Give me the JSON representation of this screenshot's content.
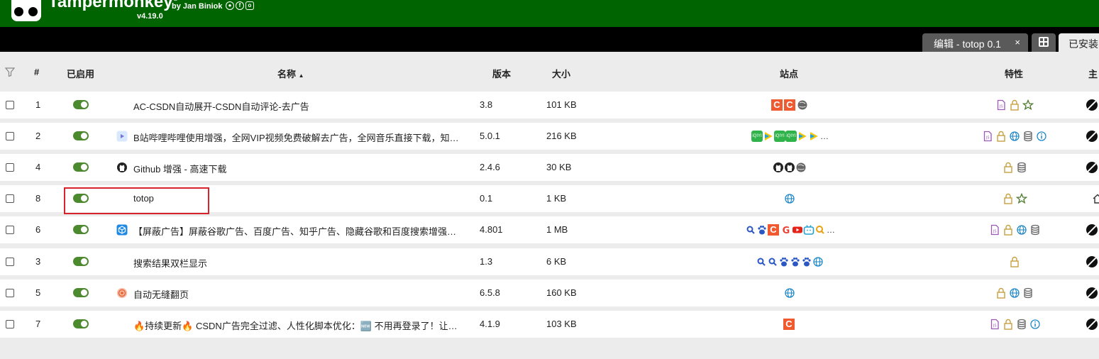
{
  "header": {
    "brand": "Tampermonkey",
    "reg_mark": "®",
    "byline": "by Jan Biniok",
    "version": "v4.19.0",
    "social_icons": [
      "github-icon",
      "facebook-icon",
      "instagram-icon"
    ],
    "bg_color": "#006400"
  },
  "tabs": {
    "edit_label": "编辑 - totop 0.1",
    "edit_close": "×",
    "installed_label": "已安装"
  },
  "table": {
    "headers": {
      "index": "#",
      "enabled": "已启用",
      "name": "名称",
      "sort_indicator": "▲",
      "version": "版本",
      "size": "大小",
      "sites": "站点",
      "features": "特性",
      "homepage": "主"
    },
    "rows": [
      {
        "index": "1",
        "enabled": true,
        "icon": "none",
        "name": "AC-CSDN自动展开-CSDN自动评论-去广告",
        "version": "3.8",
        "size": "101 KB",
        "sites": [
          "csdn-icon",
          "csdn-icon",
          "globe-gray-icon"
        ],
        "features": [
          "userscript-icon",
          "lock-icon",
          "star-icon"
        ],
        "home_icon": "homepage-icon"
      },
      {
        "index": "2",
        "enabled": true,
        "icon": "bilibili-icon",
        "name": "B站哔哩哔哩使用增强，全网VIP视频免费破解去广告，全网音乐直接下载，知…",
        "version": "5.0.1",
        "size": "216 KB",
        "sites": [
          "iqiyi-icon",
          "play-icon",
          "iqiyi-icon",
          "iqiyi-icon",
          "play-icon",
          "play-icon"
        ],
        "sites_more": "…",
        "features": [
          "userscript-icon",
          "lock-icon",
          "globe-icon",
          "database-icon",
          "info-icon"
        ],
        "home_icon": "homepage-icon"
      },
      {
        "index": "4",
        "enabled": true,
        "icon": "github-icon",
        "name": "Github 增强 - 高速下载",
        "version": "2.4.6",
        "size": "30 KB",
        "sites": [
          "github-icon",
          "github-icon",
          "globe-gray-icon"
        ],
        "features": [
          "lock-icon",
          "database-icon"
        ],
        "home_icon": "homepage-icon"
      },
      {
        "index": "8",
        "enabled": true,
        "icon": "none",
        "name": "totop",
        "version": "0.1",
        "size": "1 KB",
        "sites": [
          "globe-icon"
        ],
        "features": [
          "lock-icon",
          "star-icon"
        ],
        "home_icon": "house-icon"
      },
      {
        "index": "6",
        "enabled": true,
        "icon": "cube-icon",
        "name": "【屏蔽广告】屏蔽谷歌广告、百度广告、知乎广告、隐藏谷歌和百度搜索增强…",
        "version": "4.801",
        "size": "1 MB",
        "sites": [
          "search-icon",
          "baidu-icon",
          "csdn-icon",
          "google-icon",
          "youtube-icon",
          "bilibili-icon",
          "search-yellow-icon"
        ],
        "sites_more": "…",
        "features": [
          "userscript-icon",
          "lock-icon",
          "globe-icon",
          "database-icon"
        ],
        "home_icon": "homepage-icon"
      },
      {
        "index": "3",
        "enabled": true,
        "icon": "none",
        "name": "搜索结果双栏显示",
        "version": "1.3",
        "size": "6 KB",
        "sites": [
          "search-icon",
          "search-icon",
          "baidu-icon",
          "baidu-icon",
          "baidu-icon",
          "globe-icon"
        ],
        "features": [
          "lock-icon"
        ],
        "home_icon": "homepage-icon"
      },
      {
        "index": "5",
        "enabled": true,
        "icon": "pagetual-icon",
        "name": "自动无缝翻页",
        "version": "6.5.8",
        "size": "160 KB",
        "sites": [
          "globe-icon"
        ],
        "features": [
          "lock-icon",
          "globe-icon",
          "database-icon"
        ],
        "home_icon": "homepage-icon"
      },
      {
        "index": "7",
        "enabled": true,
        "icon": "none",
        "name": "🔥持续更新🔥 CSDN广告完全过滤、人性化脚本优化：🆕 不用再登录了！让…",
        "version": "4.1.9",
        "size": "103 KB",
        "sites": [
          "csdn-icon"
        ],
        "features": [
          "userscript-icon",
          "lock-icon",
          "database-icon",
          "info-icon"
        ],
        "home_icon": "homepage-icon"
      }
    ]
  },
  "colors": {
    "toggle_on": "#4d8a2f",
    "highlight": "#d9232c",
    "lock": "#c8a040",
    "star": "#4a7a2a",
    "globe": "#1e88c8",
    "userscript": "#9b59b6"
  }
}
